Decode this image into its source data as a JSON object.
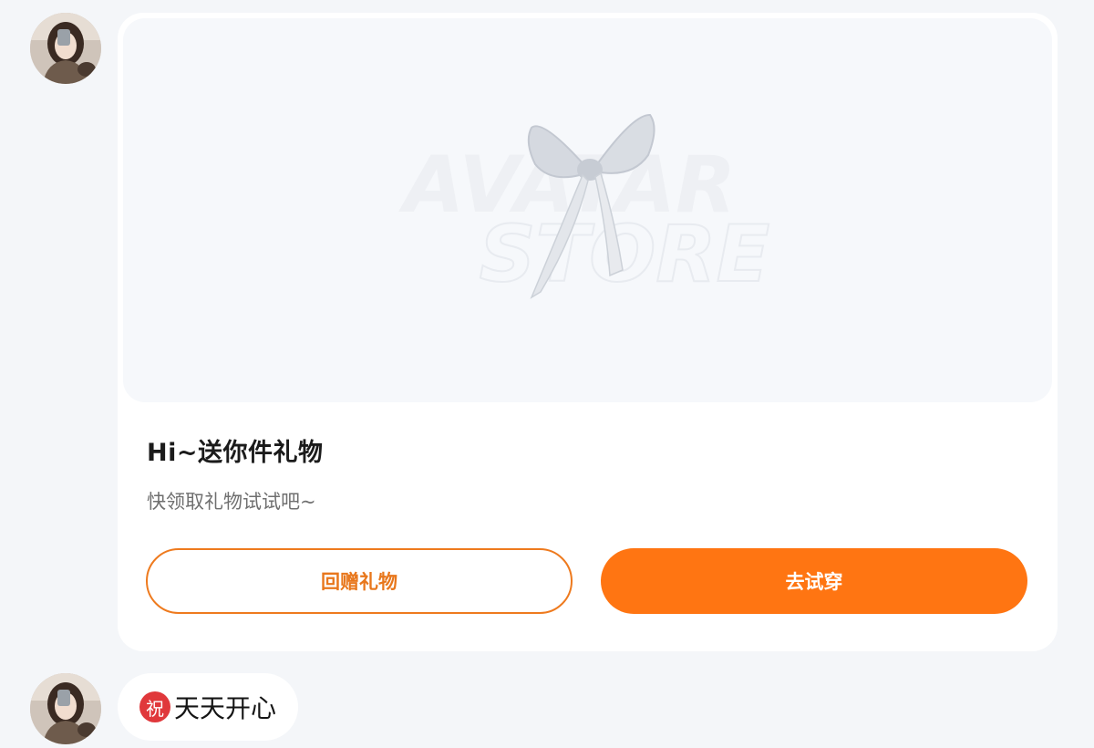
{
  "gift_card": {
    "watermark_line1": "AVATAR",
    "watermark_line2": "STORE",
    "title": "Hi~送你件礼物",
    "subtitle": "快领取礼物试试吧~",
    "return_gift_label": "回赠礼物",
    "try_on_label": "去试穿",
    "accent_color": "#ff7512"
  },
  "message": {
    "badge": "祝",
    "text": "天天开心"
  },
  "icons": {
    "gift_item": "bow-ribbon-icon",
    "wish": "wish-badge-icon"
  }
}
